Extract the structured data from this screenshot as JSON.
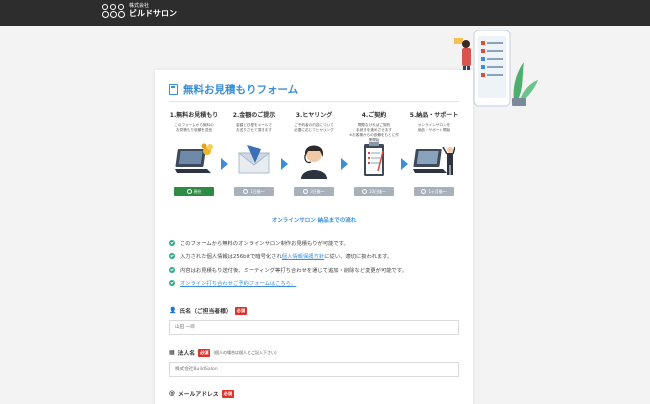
{
  "header": {
    "logo_small": "株式会社",
    "logo_name": "ビルドサロン"
  },
  "form": {
    "title": "無料お見積もりフォーム",
    "steps": [
      {
        "title": "1.無料お見積もり",
        "desc": "このフォームから無料の\nお見積もり依頼を送信",
        "status": "現在"
      },
      {
        "title": "2.金額のご提示",
        "desc": "金額と日程をメールで\nお送りさせて頂きます",
        "status": "1日後〜"
      },
      {
        "title": "3.ヒヤリング",
        "desc": "ご予約者の内容について\n必要に応じてヒヤリング",
        "status": "3日後〜"
      },
      {
        "title": "4.ご契約",
        "desc": "問題なければご契約\n手続きを進めさせます\n※お客様からの依頼をもとに作業開始",
        "status": "10日後〜"
      },
      {
        "title": "5.納品・サポート",
        "desc": "オンラインサロンを\n納品・サポート開始",
        "status": "1ヶ月後〜"
      }
    ],
    "flow_caption": "オンラインサロン 納品までの流れ",
    "notes": [
      {
        "text": "このフォームから無料のオンラインサロン制作お見積もりが可能です。"
      },
      {
        "before": "入力された個人情報は256bitで暗号化され",
        "link": "個人情報保護方針",
        "after": "に従い、適切に扱われます。"
      },
      {
        "text": "内容はお見積もり送付後、ミーティング等打ち合わせを通じて追加・削除など変更が可能です。"
      },
      {
        "link": "オンライン打ち合わせご予約フォームはこちら。"
      }
    ],
    "fields": [
      {
        "label": "氏名（ご担当者様）",
        "required": "必須",
        "placeholder": "山田 一郎",
        "sub": ""
      },
      {
        "label": "法人名",
        "required": "必須",
        "placeholder": "株式会社BuildSalon",
        "sub": "(個人の場合は個人とご記入下さい)"
      },
      {
        "label": "メールアドレス",
        "required": "必須",
        "placeholder": "",
        "sub": ""
      }
    ]
  },
  "colors": {
    "accent": "#3b8fd8",
    "header_bg": "#2d2d2d",
    "current_status": "#2e8b44",
    "future_status": "#a7b1bc",
    "required": "#e0322b"
  }
}
